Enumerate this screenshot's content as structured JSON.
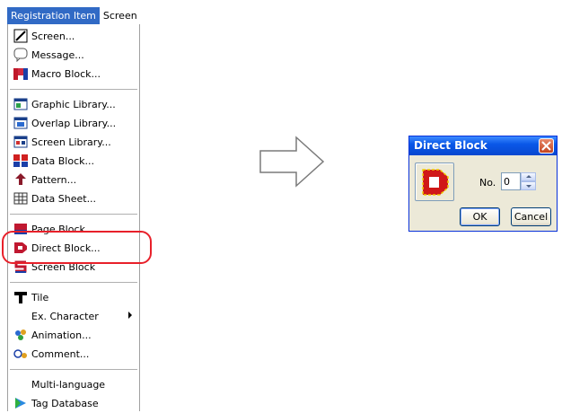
{
  "menubar": {
    "active": "Registration Item",
    "next": "Screen"
  },
  "menu": {
    "items": [
      {
        "label": "Screen...",
        "icon": "screen-icon"
      },
      {
        "label": "Message...",
        "icon": "message-icon"
      },
      {
        "label": "Macro Block...",
        "icon": "macro-block-icon"
      },
      {
        "label": "Graphic Library...",
        "icon": "graphic-library-icon"
      },
      {
        "label": "Overlap Library...",
        "icon": "overlap-library-icon"
      },
      {
        "label": "Screen Library...",
        "icon": "screen-library-icon"
      },
      {
        "label": "Data Block...",
        "icon": "data-block-icon"
      },
      {
        "label": "Pattern...",
        "icon": "pattern-icon"
      },
      {
        "label": "Data Sheet...",
        "icon": "data-sheet-icon"
      },
      {
        "label": "Page Block",
        "icon": "page-block-icon"
      },
      {
        "label": "Direct Block...",
        "icon": "direct-block-icon"
      },
      {
        "label": "Screen Block",
        "icon": "screen-block-icon"
      },
      {
        "label": "Tile",
        "icon": "tile-icon"
      },
      {
        "label": "Ex. Character",
        "icon": "",
        "submenu": true
      },
      {
        "label": "Animation...",
        "icon": "animation-icon"
      },
      {
        "label": "Comment...",
        "icon": "comment-icon"
      },
      {
        "label": "Multi-language",
        "icon": ""
      },
      {
        "label": "Tag Database",
        "icon": "tag-database-icon"
      }
    ]
  },
  "dialog": {
    "title": "Direct Block",
    "no_label": "No.",
    "no_value": "0",
    "ok_label": "OK",
    "cancel_label": "Cancel"
  },
  "colors": {
    "highlight": "#e8202a",
    "menu_active": "#316ac5",
    "title_bar": "#0a58e8"
  }
}
